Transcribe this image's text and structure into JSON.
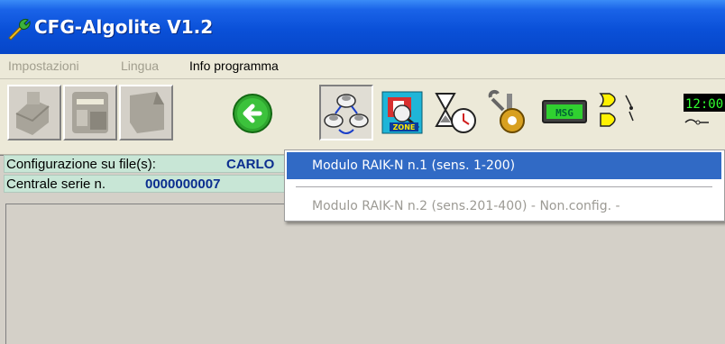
{
  "window": {
    "title": "CFG-Algolite V1.2",
    "app_icon": "wrench-icon"
  },
  "menubar": {
    "items": [
      {
        "label": "Impostazioni",
        "enabled": false
      },
      {
        "label": "Lingua",
        "enabled": false
      },
      {
        "label": "Info programma",
        "enabled": true
      }
    ]
  },
  "toolbar": {
    "buttons": [
      {
        "icon": "printer-icon",
        "enabled": false
      },
      {
        "icon": "window-icon",
        "enabled": false
      },
      {
        "icon": "card-icon",
        "enabled": false
      },
      {
        "icon": "back-arrow-icon",
        "enabled": true
      },
      {
        "icon": "sensors-network-icon",
        "enabled": true
      },
      {
        "icon": "zone-icon",
        "label": "ZONE",
        "enabled": true
      },
      {
        "icon": "hourglass-timer-icon",
        "enabled": true
      },
      {
        "icon": "tools-gear-icon",
        "enabled": true
      },
      {
        "icon": "msg-icon",
        "label": "MSG",
        "enabled": true
      },
      {
        "icon": "logic-gates-icon",
        "enabled": true
      },
      {
        "icon": "clock-display-icon",
        "label": "12:00",
        "enabled": true
      }
    ]
  },
  "status": {
    "config_label": "Configurazione su file(s):",
    "config_value": "CARLO",
    "serial_label": "Centrale serie n.",
    "serial_value": "0000000007"
  },
  "dropdown": {
    "items": [
      {
        "label": "Modulo RAIK-N n.1 (sens.  1-200)",
        "selected": true,
        "enabled": true
      },
      {
        "label": "Modulo RAIK-N n.2 (sens.201-400)  - Non.config. -",
        "selected": false,
        "enabled": false
      }
    ]
  },
  "colors": {
    "titlebar": "#0a50d8",
    "highlight": "#316ac5",
    "status_bg": "#c8e6d6",
    "status_value": "#0b2e8f",
    "back_button": "#2fa52f"
  }
}
